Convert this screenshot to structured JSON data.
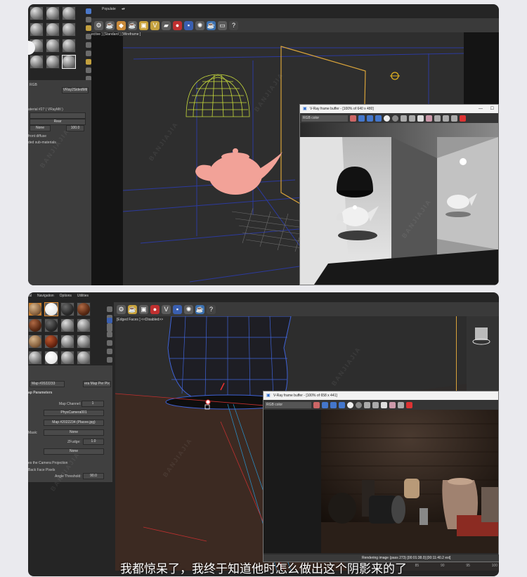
{
  "panel1": {
    "menu_label": "Populate",
    "viewport_label": "ective ] [Standard ] [Wireframe ]",
    "material_panel": {
      "type_dropdown": "VRay2SidedMtl",
      "material_name": "aterial #27  ( VRayMtl )",
      "front_label": "Rear",
      "back_map": "None",
      "back_value": "100.0",
      "front_diffuse": "front diffuse",
      "sub_materials": "ded sub-materials",
      "rgb_left": "RGB"
    },
    "vfb": {
      "title": "V-Ray frame buffer - [100% of 640 x 480]",
      "channel": "RGB color"
    }
  },
  "panel2": {
    "menus": [
      "ial",
      "Navigation",
      "Options",
      "Utilities"
    ],
    "viewport_label": "[Edged Faces ]   <<Disabled>>",
    "material_panel": {
      "map_dropdown": "Map #2022233",
      "map_type": "era Map Per Pix",
      "section": "ap Parameters",
      "map_channel_label": "Map Channel:",
      "map_channel_value": "1",
      "camera": "PhysCamera001",
      "map_file": "Map #2022234 (Placee.jpg)",
      "mask_label": "Mask:",
      "mask_value": "None",
      "zfudge_label": "ZFudge:",
      "zfudge_value": "1.0",
      "none2": "None",
      "camera_proj": "es the Camera Projection",
      "back_face": "Back Face Pixels",
      "angle_label": "Angle Threshold:",
      "angle_value": "90.0"
    },
    "vfb": {
      "title": "V-Ray frame buffer - [100% of 658 x 441]",
      "channel": "RGB color",
      "status": "Rendering image (pass 273) [00:01:38.0] [00:11:40.2 est]"
    },
    "ruler": [
      "75",
      "80",
      "85",
      "90",
      "95",
      "100"
    ]
  },
  "watermark_text": "BANJIAJIA",
  "subtitle": "我都惊呆了，我终于知道他时怎么做出这个阴影来的了",
  "colors": {
    "accent_orange": "#d9a33a",
    "wire_yellow": "#c8dc3c",
    "teapot_pink": "#f2a298",
    "grid_blue": "#2c3a9e"
  }
}
